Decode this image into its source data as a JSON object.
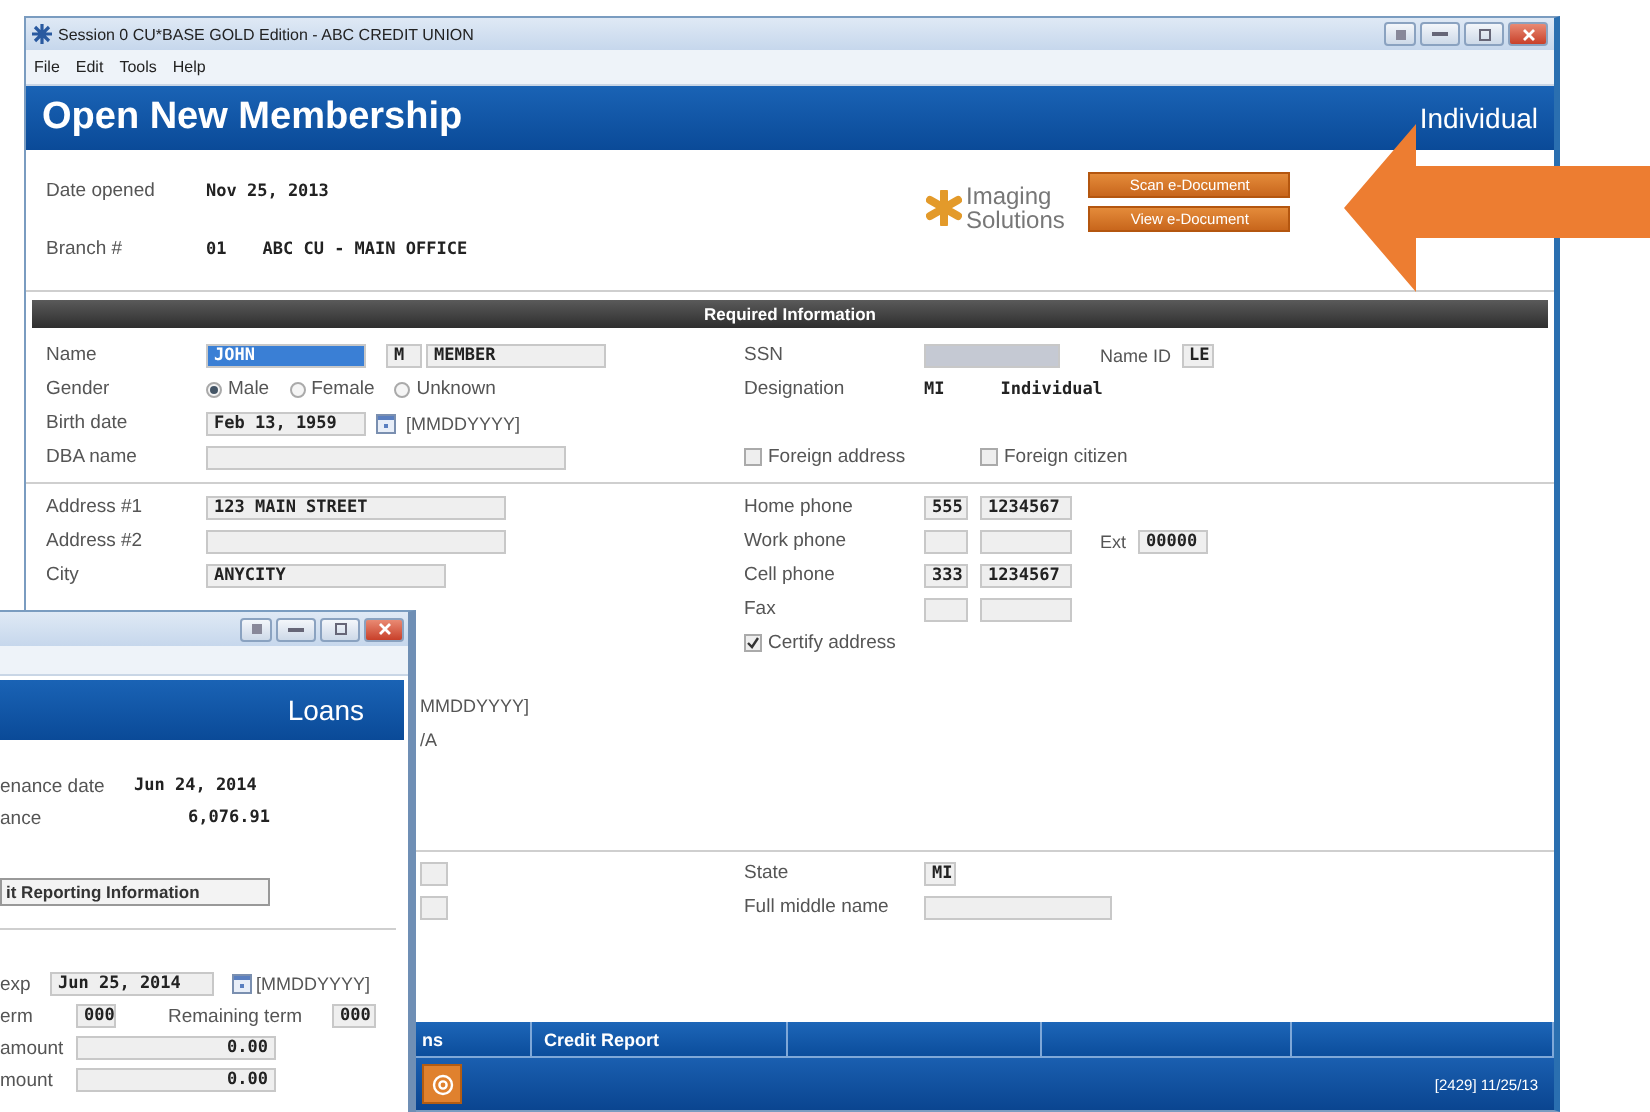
{
  "window": {
    "title": "Session 0 CU*BASE GOLD Edition - ABC CREDIT UNION",
    "menu": [
      "File",
      "Edit",
      "Tools",
      "Help"
    ],
    "heading": "Open New Membership",
    "mode": "Individual"
  },
  "top": {
    "date_opened": {
      "label": "Date opened",
      "value": "Nov 25, 2013"
    },
    "branch": {
      "label": "Branch #",
      "number": "01",
      "name": "ABC CU - MAIN OFFICE"
    }
  },
  "imaging": {
    "logo": [
      "Imaging",
      "Solutions"
    ],
    "buttons": [
      "Scan e-Document",
      "View e-Document"
    ]
  },
  "required": {
    "title": "Required Information",
    "name": {
      "label": "Name",
      "first": "JOHN",
      "first_selected": true,
      "middle": "M",
      "last": "MEMBER"
    },
    "gender": {
      "label": "Gender",
      "options": [
        {
          "label": "Male",
          "selected": true
        },
        {
          "label": "Female",
          "selected": false
        },
        {
          "label": "Unknown",
          "selected": false
        }
      ]
    },
    "birth_date": {
      "label": "Birth date",
      "value": "Feb 13, 1959",
      "hint": "[MMDDYYYY]"
    },
    "dba_name": {
      "label": "DBA name"
    },
    "ssn": {
      "label": "SSN"
    },
    "name_id": {
      "label": "Name ID",
      "value": "LE"
    },
    "designation": {
      "label": "Designation",
      "code": "MI",
      "value": "Individual"
    },
    "flags": [
      {
        "label": "Foreign address",
        "checked": false
      },
      {
        "label": "Foreign citizen",
        "checked": false
      }
    ]
  },
  "address": {
    "address_1": {
      "label": "Address #1",
      "value": "123 MAIN STREET"
    },
    "address_2": {
      "label": "Address #2"
    },
    "city": {
      "label": "City",
      "value": "ANYCITY"
    },
    "phones": [
      {
        "label": "Home phone",
        "area": "555",
        "number": "1234567"
      },
      {
        "label": "Work phone",
        "ext_label": "Ext",
        "ext": "00000"
      },
      {
        "label": "Cell phone",
        "area": "333",
        "number": "1234567"
      },
      {
        "label": "Fax"
      }
    ],
    "certify": {
      "label": "Certify address",
      "checked": true
    }
  },
  "covered_texts": [
    "MMDDYYYY]",
    "/A"
  ],
  "lower": {
    "state": {
      "label": "State",
      "value": "MI"
    },
    "full_middle_name": {
      "label": "Full middle name"
    }
  },
  "bottom_tabs": [
    "ns",
    "Credit Report"
  ],
  "status": "[2429] 11/25/13",
  "loans_window": {
    "heading": "Loans",
    "fields": [
      {
        "label": "enance date",
        "value": "Jun 24, 2014"
      },
      {
        "label": "ance",
        "value": "6,076.91"
      }
    ],
    "button": "it Reporting Information",
    "exp": {
      "label": "exp",
      "value": "Jun 25, 2014",
      "hint": "[MMDDYYYY]"
    },
    "term": {
      "label": "erm",
      "value": "000",
      "remaining_label": "Remaining term",
      "remaining": "000"
    },
    "amounts": [
      {
        "label": "amount",
        "value": "0.00"
      },
      {
        "label": "mount",
        "value": "0.00"
      }
    ]
  }
}
